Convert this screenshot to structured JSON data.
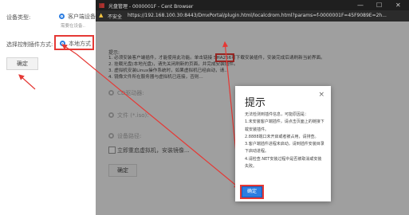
{
  "left_panel": {
    "device_type_label": "设备类型:",
    "client_device_option": "客户端设备",
    "client_sub": "需要在设备..",
    "plugin_mode_label": "选择控制插件方式:",
    "local_mode_option": "本地方式",
    "confirm_label": "确定"
  },
  "browser": {
    "title": "光盘管理 - 0000001F - Cent Browser",
    "security": "不安全",
    "url": "https://192.168.100.30:8443/DmxPortal/plugin.html/localcdrom.html?params=f-0000001F=45F9089E=2h...",
    "minimize": "—",
    "maximize": "☐",
    "close": "✕"
  },
  "page": {
    "hint_label": "提示:",
    "hint_lines": [
      "1. 必须安装客户端插件，才能使用此功能。单击链接 SHA256可下载安装插件，安装完成后请刷新当前界面。",
      "2. 挂载光盘(本地光盘)，请先关闭刷新的页面，并完成安装插件。",
      "3. 虚拟机安装Linux操作系统时，如果虚拟机已经启动，请...",
      "4. 镜像文件所在服务器与虚拟机已连接，否则..."
    ],
    "link_text": "链接",
    "cd_label": "CD驱动器:",
    "file_label": "文件 (*.iso):",
    "device_label": "设备路径:",
    "reboot_label": "立即重启虚拟机，安装镜像...",
    "confirm_label": "确定"
  },
  "modal": {
    "title": "提示",
    "close": "×",
    "lines": [
      "无法检测到插件信息，可能原因是：",
      "1.未安装客户端插件，请点击页面上的链接下载安装插件。",
      "2.8888端口未开启或者被占用，请排查。",
      "3.客户端插件进程未启动，请到插件安装目录下启动进程。",
      "4.请检查.NET安装过程中是否被取消或安装失败。"
    ],
    "ok_label": "确定"
  }
}
